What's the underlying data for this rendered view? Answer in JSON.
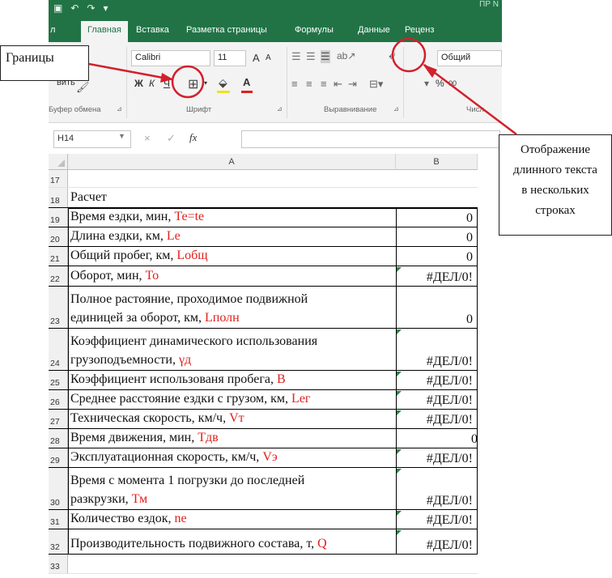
{
  "window": {
    "title_fragment": "ПР N"
  },
  "ribbon": {
    "tabs": [
      "л",
      "Главная",
      "Вставка",
      "Разметка страницы",
      "Формулы",
      "Данные",
      "Реценз"
    ],
    "active_tab": "Главная",
    "clipboard": {
      "paste_label": "вить",
      "group_label": "Буфер обмена"
    },
    "font": {
      "name": "Calibri",
      "size": "11",
      "grow": "A",
      "shrink": "A",
      "bold": "Ж",
      "italic": "К",
      "underline": "Ч",
      "font_color": "А",
      "group_label": "Шрифт"
    },
    "alignment": {
      "group_label": "Выравнивание"
    },
    "number": {
      "format": "Общий",
      "percent": "%",
      "thousands": "00",
      "group_label": "Числ"
    }
  },
  "formula_bar": {
    "name_box": "H14",
    "fx": "fx",
    "cancel": "×",
    "enter": "✓",
    "value": ""
  },
  "columns": [
    "A",
    "B"
  ],
  "rows": [
    {
      "num": "17",
      "label": "",
      "var": "",
      "value": ""
    },
    {
      "num": "18",
      "label": "Расчет",
      "var": "",
      "value": ""
    },
    {
      "num": "19",
      "label": "Время ездки, мин, ",
      "var": "Те=te",
      "value": "0"
    },
    {
      "num": "20",
      "label": "Длина ездки, км, ",
      "var": "Le",
      "value": "0"
    },
    {
      "num": "21",
      "label": "Общий пробег, км, ",
      "var": "Lобщ",
      "value": "0"
    },
    {
      "num": "22",
      "label": "Оборот, мин, ",
      "var": "То",
      "value": "#ДЕЛ/0!"
    },
    {
      "num": "23",
      "label_line1": "Полное растояние, проходимое подвижной",
      "label": "единицей за оборот, км, ",
      "var": "Lполн",
      "value": "0"
    },
    {
      "num": "24",
      "label_line1": "Коэффициент динамического использования",
      "label": "грузоподъемности, ",
      "var": "γд",
      "value": "#ДЕЛ/0!"
    },
    {
      "num": "25",
      "label": "Коэффициент использованя пробега, ",
      "var": "В",
      "value": "#ДЕЛ/0!"
    },
    {
      "num": "26",
      "label": "Среднее расстояние ездки с грузом, км, ",
      "var": "Lег",
      "value": "#ДЕЛ/0!"
    },
    {
      "num": "27",
      "label": "Техническая скорость, км/ч, ",
      "var": "Vт",
      "value": "#ДЕЛ/0!"
    },
    {
      "num": "28",
      "label": "Время движения, мин, ",
      "var": "Тдв",
      "value": "0"
    },
    {
      "num": "29",
      "label": "Эксплуатационная скорость, км/ч, ",
      "var": "Vэ",
      "value": "#ДЕЛ/0!"
    },
    {
      "num": "30",
      "label_line1": "Время с момента 1 погрузки до последней",
      "label": "разкрузки, ",
      "var": "Тм",
      "value": "#ДЕЛ/0!"
    },
    {
      "num": "31",
      "label": "Количество ездок, ",
      "var": "ne",
      "value": "#ДЕЛ/0!"
    },
    {
      "num": "32",
      "label": "Производительность подвижного состава, т, ",
      "var": "Q",
      "value": "#ДЕЛ/0!"
    },
    {
      "num": "33",
      "label": "",
      "var": "",
      "value": ""
    }
  ],
  "annotations": {
    "borders": "Границы",
    "wrap_text": [
      "Отображение",
      "длинного текста",
      "в нескольких",
      "строках"
    ]
  },
  "colors": {
    "ribbon": "#217346",
    "annotation_arrow": "#d2202c",
    "variable_text": "#e0201c"
  }
}
